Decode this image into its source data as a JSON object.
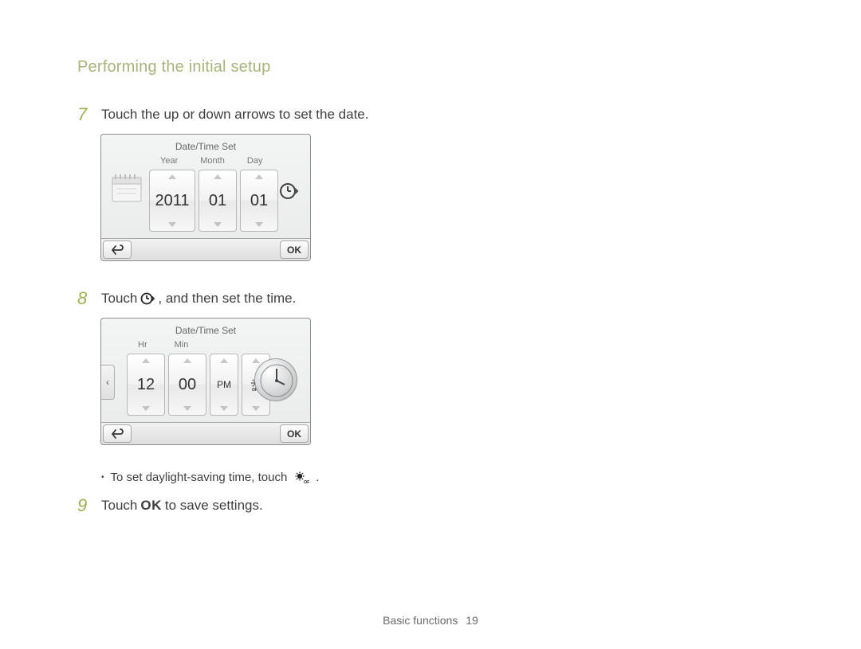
{
  "page_title": "Performing the initial setup",
  "steps": {
    "s7": {
      "num": "7",
      "text": "Touch the up or down arrows to set the date."
    },
    "s8": {
      "num": "8",
      "pre": "Touch ",
      "post": ", and then set the time."
    },
    "s9": {
      "num": "9",
      "pre": "Touch ",
      "ok_label": "OK",
      "post": " to save settings."
    }
  },
  "bullet_dst": {
    "pre": "To set daylight-saving time, touch ",
    "post": "."
  },
  "device_date": {
    "header": "Date/Time Set",
    "labels": {
      "year": "Year",
      "month": "Month",
      "day": "Day"
    },
    "year": "2011",
    "month": "01",
    "day": "01",
    "ok": "OK"
  },
  "device_time": {
    "header": "Date/Time Set",
    "labels": {
      "hr": "Hr",
      "min": "Min"
    },
    "hr": "12",
    "min": "00",
    "ampm": "PM",
    "ok": "OK"
  },
  "footer": {
    "section": "Basic functions",
    "page": "19"
  }
}
